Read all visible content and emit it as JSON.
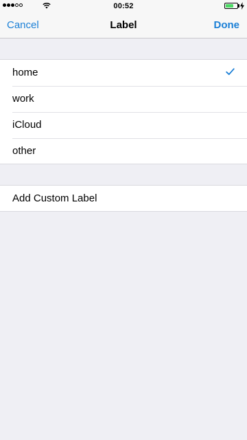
{
  "status_bar": {
    "time": "00:52",
    "signal_bars": 5,
    "signal_filled": 3,
    "battery_level": 0.7,
    "battery_color": "#4cd964",
    "charging": true
  },
  "nav": {
    "cancel_label": "Cancel",
    "title": "Label",
    "done_label": "Done",
    "accent_color": "#1a7fd6"
  },
  "labels": [
    {
      "label": "home",
      "selected": true
    },
    {
      "label": "work",
      "selected": false
    },
    {
      "label": "iCloud",
      "selected": false
    },
    {
      "label": "other",
      "selected": false
    }
  ],
  "custom": {
    "add_label": "Add Custom Label"
  },
  "icons": {
    "selected_marker": "checkmark-icon",
    "signal": "signal-strength-icon",
    "wifi": "wifi-icon",
    "battery": "battery-icon",
    "charging": "charging-bolt-icon"
  }
}
